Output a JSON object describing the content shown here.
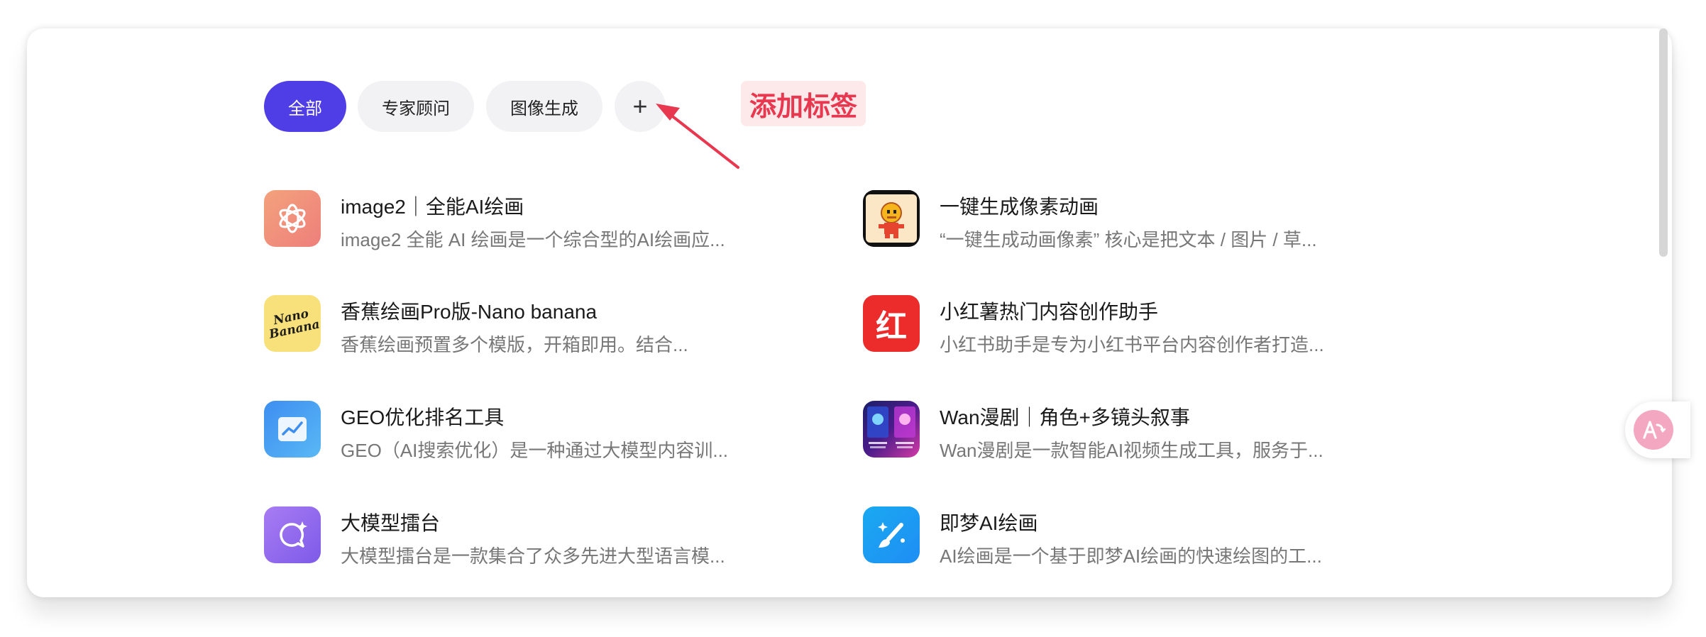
{
  "tabs": [
    {
      "label": "全部",
      "active": true
    },
    {
      "label": "专家顾问",
      "active": false
    },
    {
      "label": "图像生成",
      "active": false
    }
  ],
  "add_tab_label": "+",
  "annotation": "添加标签",
  "accent_color": "#4f3ee6",
  "annotation_color": "#e8384f",
  "items": [
    {
      "title": "image2｜全能AI绘画",
      "desc": "image2 全能 AI 绘画是一个综合型的AI绘画应...",
      "icon": "openai-logo-icon"
    },
    {
      "title": "一键生成像素动画",
      "desc": "“一键生成动画像素” 核心是把文本 / 图片 / 草...",
      "icon": "pixel-character-icon"
    },
    {
      "title": "香蕉绘画Pro版-Nano banana",
      "desc": "香蕉绘画预置多个模版，开箱即用。结合...",
      "icon": "nano-banana-icon",
      "icon_text": "Nano Banana"
    },
    {
      "title": "小红薯热门内容创作助手",
      "desc": "小红书助手是专为小红书平台内容创作者打造...",
      "icon": "xiaohongshu-icon",
      "icon_text": "红"
    },
    {
      "title": "GEO优化排名工具",
      "desc": "GEO（AI搜索优化）是一种通过大模型内容训...",
      "icon": "chart-trend-icon"
    },
    {
      "title": "Wan漫剧｜角色+多镜头叙事",
      "desc": "Wan漫剧是一款智能AI视频生成工具，服务于...",
      "icon": "wan-comic-icon"
    },
    {
      "title": "大模型擂台",
      "desc": "大模型擂台是一款集合了众多先进大型语言模...",
      "icon": "chat-sparkle-icon"
    },
    {
      "title": "即梦AI绘画",
      "desc": "AI绘画是一个基于即梦AI绘画的快速绘图的工...",
      "icon": "paintbrush-sparkle-icon"
    }
  ],
  "side_button_icon": "translate-icon"
}
